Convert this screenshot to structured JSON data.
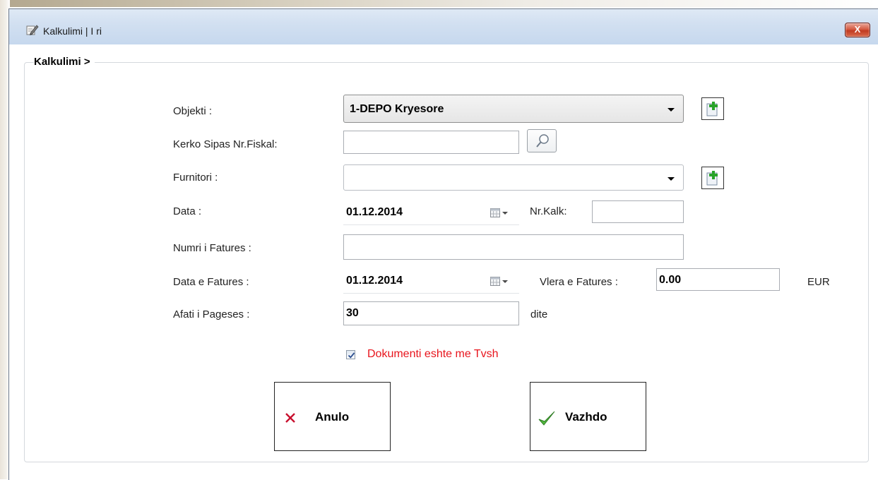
{
  "window": {
    "title": "Kalkulimi | I ri",
    "close_label": "X"
  },
  "group": {
    "legend": "Kalkulimi >"
  },
  "form": {
    "objekti": {
      "label": "Objekti :",
      "value": "1-DEPO Kryesore"
    },
    "kerko": {
      "label": "Kerko Sipas Nr.Fiskal:",
      "value": ""
    },
    "furnitori": {
      "label": "Furnitori :",
      "value": ""
    },
    "data": {
      "label": "Data :",
      "value": "01.12.2014"
    },
    "nr_kalk": {
      "label": "Nr.Kalk:",
      "value": ""
    },
    "numri_fatures": {
      "label": "Numri i Fatures :",
      "value": ""
    },
    "data_fatures": {
      "label": "Data e Fatures :",
      "value": "01.12.2014"
    },
    "vlera_fatures": {
      "label": "Vlera e Fatures :",
      "value": "0.00",
      "currency": "EUR"
    },
    "afati_pageses": {
      "label": "Afati i Pageses :",
      "value": "30",
      "unit": "dite"
    },
    "tvsh_checkbox": {
      "label": "Dokumenti eshte me Tvsh",
      "checked": true
    }
  },
  "buttons": {
    "anulo": "Anulo",
    "vazhdo": "Vazhdo"
  },
  "icons": {
    "app": "pencil-edit-icon",
    "add": "add-green-plus-icon",
    "search": "magnifier-icon",
    "calendar": "calendar-icon",
    "cancel": "red-x-icon",
    "confirm": "green-check-icon"
  },
  "colors": {
    "checkbox_label": "#e8141c",
    "cancel_icon": "#c8102e",
    "confirm_icon": "#3da32e",
    "titlebar": "#d2e0f1"
  }
}
